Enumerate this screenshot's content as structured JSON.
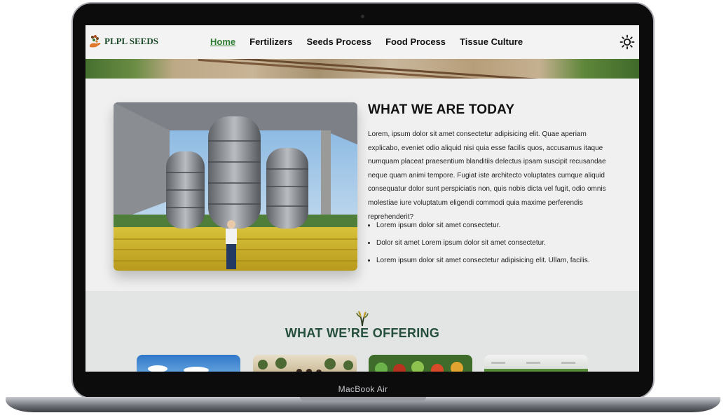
{
  "device": {
    "model_label": "MacBook Air"
  },
  "brand": {
    "logo_text": "PLPL SEEDS"
  },
  "nav": {
    "items": [
      {
        "label": "Home",
        "active": true
      },
      {
        "label": "Fertilizers"
      },
      {
        "label": "Seeds Process"
      },
      {
        "label": "Food Process"
      },
      {
        "label": "Tissue Culture"
      }
    ],
    "theme_toggle_icon": "sun-icon"
  },
  "about": {
    "title": "WHAT WE ARE TODAY",
    "paragraph": "Lorem, ipsum dolor sit amet consectetur adipisicing elit. Quae aperiam explicabo, eveniet odio aliquid nisi quia esse facilis quos, accusamus itaque numquam placeat praesentium blanditiis delectus ipsam suscipit recusandae neque quam animi tempore. Fugiat iste architecto voluptates cumque aliquid consequatur dolor sunt perspiciatis non, quis nobis dicta vel fugit, odio omnis molestiae iure voluptatum eligendi commodi quia maxime perferendis reprehenderit?",
    "bullets": [
      "Lorem ipsum dolor sit amet consectetur.",
      "Dolor sit amet Lorem ipsum dolor sit amet consectetur.",
      "Lorem ipsum dolor sit amet consectetur adipisicing elit. Ullam, facilis."
    ]
  },
  "offering": {
    "title": "WHAT WE’RE OFFERING",
    "icon": "wheat-icon"
  },
  "colors": {
    "accent_green": "#2e7d32",
    "heading_dark_green": "#254f3c",
    "section_bg": "#f0f0f0",
    "offering_bg": "#e2e5e3"
  }
}
